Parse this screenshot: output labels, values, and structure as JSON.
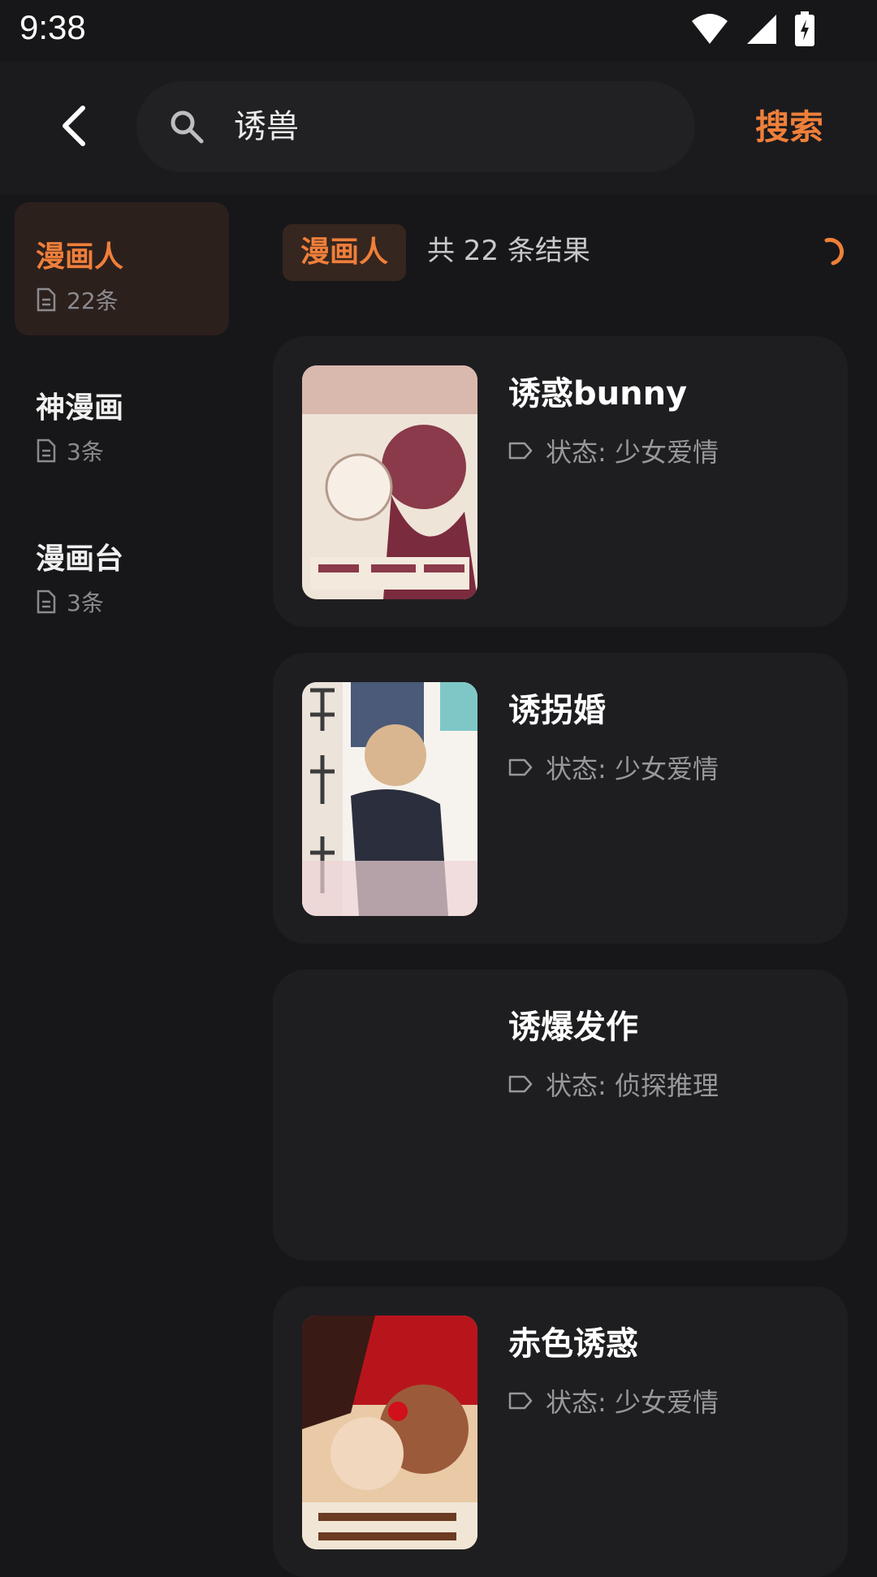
{
  "status_bar": {
    "time": "9:38"
  },
  "search": {
    "query": "诱兽",
    "button_label": "搜索"
  },
  "sources": [
    {
      "name": "漫画人",
      "count": "22条",
      "active": true
    },
    {
      "name": "神漫画",
      "count": "3条",
      "active": false
    },
    {
      "name": "漫画台",
      "count": "3条",
      "active": false
    }
  ],
  "results": {
    "source_chip": "漫画人",
    "count_text": "共 22 条结果",
    "items": [
      {
        "title": "诱惑bunny",
        "status": "状态: 少女爱情"
      },
      {
        "title": "诱拐婚",
        "status": "状态: 少女爱情"
      },
      {
        "title": "诱爆发作",
        "status": "状态: 侦探推理"
      },
      {
        "title": "赤色诱惑",
        "status": "状态: 少女爱情"
      }
    ]
  },
  "colors": {
    "accent": "#ef7f3a",
    "background": "#171719",
    "card": "#1e1e21"
  }
}
